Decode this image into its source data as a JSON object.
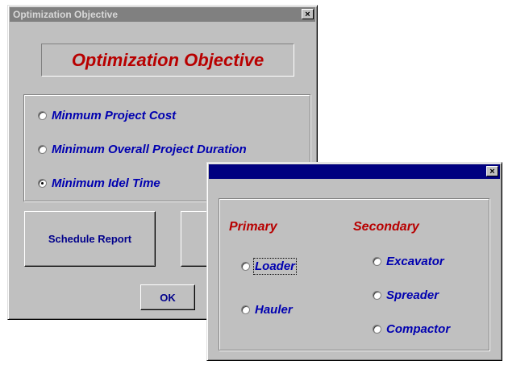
{
  "main_dialog": {
    "title": "Optimization Objective",
    "close_glyph": "×",
    "heading": "Optimization Objective",
    "options": [
      {
        "label": "Minmum Project Cost",
        "checked": false
      },
      {
        "label": "Minimum Overall Project Duration",
        "checked": false
      },
      {
        "label": "Minimum Idel Time",
        "checked": true
      }
    ],
    "schedule_report_label": "Schedule Report",
    "ok_label": "OK"
  },
  "equipment_dialog": {
    "title": "",
    "close_glyph": "×",
    "primary_heading": "Primary",
    "secondary_heading": "Secondary",
    "primary_options": [
      {
        "label": "Loader",
        "checked": false,
        "focused": true
      },
      {
        "label": "Hauler",
        "checked": false
      }
    ],
    "secondary_options": [
      {
        "label": "Excavator",
        "checked": false
      },
      {
        "label": "Spreader",
        "checked": false
      },
      {
        "label": "Compactor",
        "checked": false
      }
    ]
  },
  "colors": {
    "inactive_title": "#808080",
    "active_title": "#000080",
    "label_blue": "#0000b0",
    "heading_red": "#b80000",
    "face": "#c0c0c0"
  }
}
